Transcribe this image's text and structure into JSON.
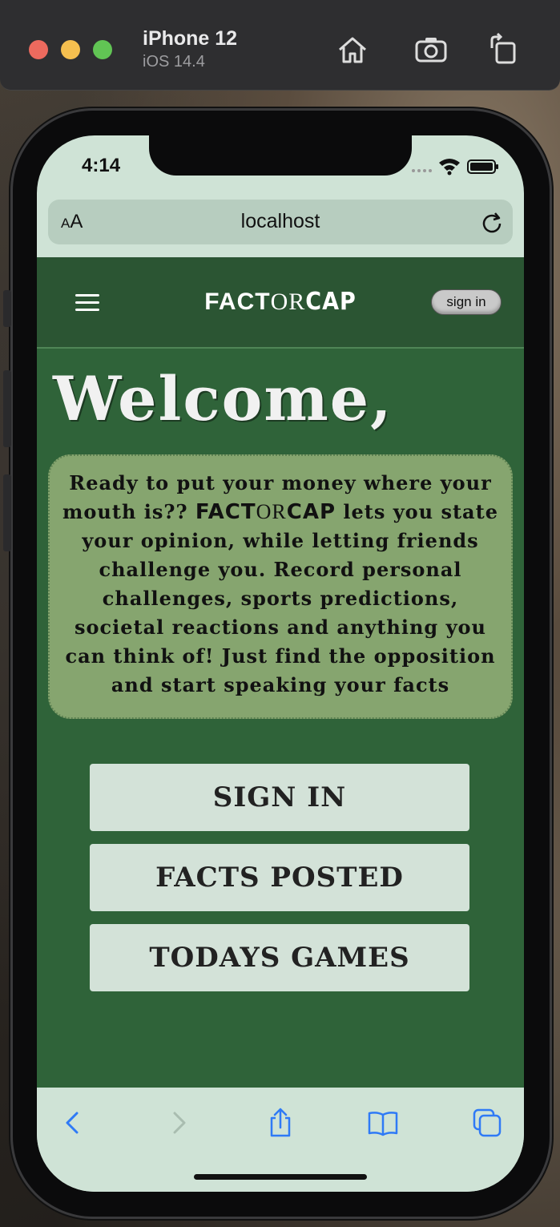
{
  "simulator": {
    "device": "iPhone 12",
    "os": "iOS 14.4"
  },
  "status_bar": {
    "time": "4:14"
  },
  "browser": {
    "text_size_label": "AA",
    "url": "localhost"
  },
  "site": {
    "logo": {
      "fact": "FACT",
      "or": "OR",
      "cap": "CAP"
    },
    "signin_pill": "sign in",
    "welcome": "Welcome,",
    "intro": {
      "before": "Ready to put your money where your mouth is?? ",
      "brand_fact": "FACT",
      "brand_or": "OR",
      "brand_cap": "CAP",
      "after": " lets you state your opinion, while letting friends challenge you. Record personal challenges, sports predictions, societal reactions and anything you can think of! Just find the opposition and start speaking your facts"
    },
    "buttons": {
      "sign_in": "SIGN IN",
      "facts_posted": "FACTS POSTED",
      "todays_games": "TODAYS GAMES"
    }
  },
  "colors": {
    "site_background": "#2f6339",
    "header_background": "#2b5533",
    "intro_box": "#86a56f",
    "button_background": "#d3e2d8",
    "browser_chrome": "#cfe3d6",
    "toolbar_icon": "#2f7af6"
  },
  "icons": {
    "simulator": [
      "home-icon",
      "screenshot-icon",
      "rotate-icon"
    ],
    "toolbar": [
      "back-icon",
      "forward-icon",
      "share-icon",
      "bookmarks-icon",
      "tabs-icon"
    ]
  }
}
